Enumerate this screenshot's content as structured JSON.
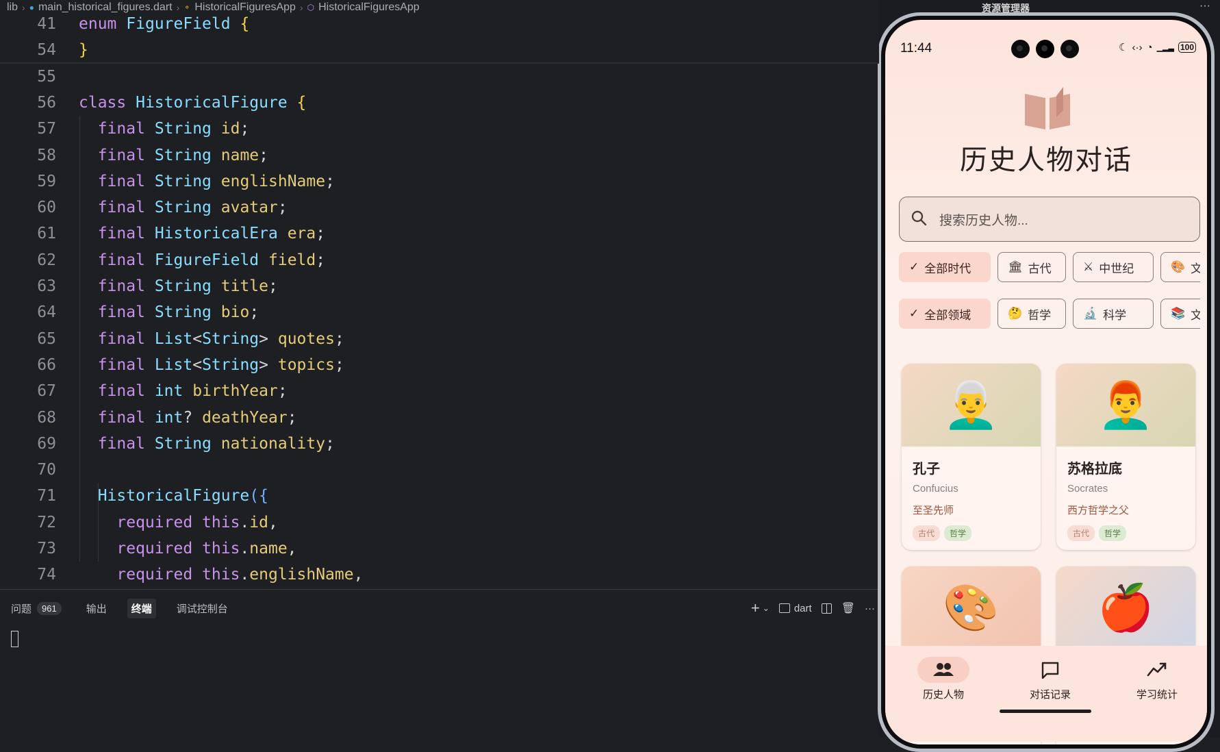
{
  "breadcrumb": {
    "root": "lib",
    "file": "main_historical_figures.dart",
    "class1": "HistoricalFiguresApp",
    "class2": "HistoricalFiguresApp"
  },
  "code": {
    "sticky": [
      {
        "num": "41",
        "tokens": [
          [
            "k",
            "enum"
          ],
          [
            "p",
            " "
          ],
          [
            "t",
            "FigureField"
          ],
          [
            "p",
            " "
          ],
          [
            "b",
            "{"
          ]
        ]
      },
      {
        "num": "54",
        "tokens": [
          [
            "b",
            "}"
          ]
        ]
      }
    ],
    "lines": [
      {
        "num": "55",
        "tokens": []
      },
      {
        "num": "56",
        "tokens": [
          [
            "k",
            "class"
          ],
          [
            "p",
            " "
          ],
          [
            "t",
            "HistoricalFigure"
          ],
          [
            "p",
            " "
          ],
          [
            "b",
            "{"
          ]
        ]
      },
      {
        "num": "57",
        "tokens": [
          [
            "p",
            "  "
          ],
          [
            "k",
            "final"
          ],
          [
            "p",
            " "
          ],
          [
            "t",
            "String"
          ],
          [
            "p",
            " "
          ],
          [
            "f",
            "id"
          ],
          [
            "p",
            ";"
          ]
        ]
      },
      {
        "num": "58",
        "tokens": [
          [
            "p",
            "  "
          ],
          [
            "k",
            "final"
          ],
          [
            "p",
            " "
          ],
          [
            "t",
            "String"
          ],
          [
            "p",
            " "
          ],
          [
            "f",
            "name"
          ],
          [
            "p",
            ";"
          ]
        ]
      },
      {
        "num": "59",
        "tokens": [
          [
            "p",
            "  "
          ],
          [
            "k",
            "final"
          ],
          [
            "p",
            " "
          ],
          [
            "t",
            "String"
          ],
          [
            "p",
            " "
          ],
          [
            "f",
            "englishName"
          ],
          [
            "p",
            ";"
          ]
        ]
      },
      {
        "num": "60",
        "tokens": [
          [
            "p",
            "  "
          ],
          [
            "k",
            "final"
          ],
          [
            "p",
            " "
          ],
          [
            "t",
            "String"
          ],
          [
            "p",
            " "
          ],
          [
            "f",
            "avatar"
          ],
          [
            "p",
            ";"
          ]
        ]
      },
      {
        "num": "61",
        "tokens": [
          [
            "p",
            "  "
          ],
          [
            "k",
            "final"
          ],
          [
            "p",
            " "
          ],
          [
            "t",
            "HistoricalEra"
          ],
          [
            "p",
            " "
          ],
          [
            "f",
            "era"
          ],
          [
            "p",
            ";"
          ]
        ]
      },
      {
        "num": "62",
        "tokens": [
          [
            "p",
            "  "
          ],
          [
            "k",
            "final"
          ],
          [
            "p",
            " "
          ],
          [
            "t",
            "FigureField"
          ],
          [
            "p",
            " "
          ],
          [
            "f",
            "field"
          ],
          [
            "p",
            ";"
          ]
        ]
      },
      {
        "num": "63",
        "tokens": [
          [
            "p",
            "  "
          ],
          [
            "k",
            "final"
          ],
          [
            "p",
            " "
          ],
          [
            "t",
            "String"
          ],
          [
            "p",
            " "
          ],
          [
            "f",
            "title"
          ],
          [
            "p",
            ";"
          ]
        ]
      },
      {
        "num": "64",
        "tokens": [
          [
            "p",
            "  "
          ],
          [
            "k",
            "final"
          ],
          [
            "p",
            " "
          ],
          [
            "t",
            "String"
          ],
          [
            "p",
            " "
          ],
          [
            "f",
            "bio"
          ],
          [
            "p",
            ";"
          ]
        ]
      },
      {
        "num": "65",
        "tokens": [
          [
            "p",
            "  "
          ],
          [
            "k",
            "final"
          ],
          [
            "p",
            " "
          ],
          [
            "t",
            "List"
          ],
          [
            "p",
            "<"
          ],
          [
            "t",
            "String"
          ],
          [
            "p",
            "> "
          ],
          [
            "f",
            "quotes"
          ],
          [
            "p",
            ";"
          ]
        ]
      },
      {
        "num": "66",
        "tokens": [
          [
            "p",
            "  "
          ],
          [
            "k",
            "final"
          ],
          [
            "p",
            " "
          ],
          [
            "t",
            "List"
          ],
          [
            "p",
            "<"
          ],
          [
            "t",
            "String"
          ],
          [
            "p",
            "> "
          ],
          [
            "f",
            "topics"
          ],
          [
            "p",
            ";"
          ]
        ]
      },
      {
        "num": "67",
        "tokens": [
          [
            "p",
            "  "
          ],
          [
            "k",
            "final"
          ],
          [
            "p",
            " "
          ],
          [
            "t",
            "int"
          ],
          [
            "p",
            " "
          ],
          [
            "f",
            "birthYear"
          ],
          [
            "p",
            ";"
          ]
        ]
      },
      {
        "num": "68",
        "tokens": [
          [
            "p",
            "  "
          ],
          [
            "k",
            "final"
          ],
          [
            "p",
            " "
          ],
          [
            "t",
            "int"
          ],
          [
            "p",
            "? "
          ],
          [
            "f",
            "deathYear"
          ],
          [
            "p",
            ";"
          ]
        ]
      },
      {
        "num": "69",
        "tokens": [
          [
            "p",
            "  "
          ],
          [
            "k",
            "final"
          ],
          [
            "p",
            " "
          ],
          [
            "t",
            "String"
          ],
          [
            "p",
            " "
          ],
          [
            "f",
            "nationality"
          ],
          [
            "p",
            ";"
          ]
        ]
      },
      {
        "num": "70",
        "tokens": []
      },
      {
        "num": "71",
        "tokens": [
          [
            "p",
            "  "
          ],
          [
            "t",
            "HistoricalFigure"
          ],
          [
            "b2",
            "({"
          ]
        ]
      },
      {
        "num": "72",
        "tokens": [
          [
            "p",
            "    "
          ],
          [
            "k",
            "required"
          ],
          [
            "p",
            " "
          ],
          [
            "k",
            "this"
          ],
          [
            "p",
            "."
          ],
          [
            "f",
            "id"
          ],
          [
            "p",
            ","
          ]
        ]
      },
      {
        "num": "73",
        "tokens": [
          [
            "p",
            "    "
          ],
          [
            "k",
            "required"
          ],
          [
            "p",
            " "
          ],
          [
            "k",
            "this"
          ],
          [
            "p",
            "."
          ],
          [
            "f",
            "name"
          ],
          [
            "p",
            ","
          ]
        ]
      },
      {
        "num": "74",
        "tokens": [
          [
            "p",
            "    "
          ],
          [
            "k",
            "required"
          ],
          [
            "p",
            " "
          ],
          [
            "k",
            "this"
          ],
          [
            "p",
            "."
          ],
          [
            "f",
            "englishName"
          ],
          [
            "p",
            ","
          ]
        ]
      }
    ]
  },
  "panel": {
    "tabs": [
      {
        "label": "问题",
        "badge": "961",
        "active": false
      },
      {
        "label": "输出",
        "active": false
      },
      {
        "label": "终端",
        "active": true
      },
      {
        "label": "调试控制台",
        "active": false
      }
    ],
    "actions": {
      "add": "+",
      "add_menu": "⌄",
      "terminal_name": "dart",
      "more": "···"
    }
  },
  "explorer": {
    "title": "资源管理器",
    "more": "···"
  },
  "phone": {
    "time": "11:44",
    "battery": "100",
    "app_title": "历史人物对话",
    "search_placeholder": "搜索历史人物...",
    "era_chips": [
      {
        "icon": "✓",
        "label": "全部时代",
        "selected": true
      },
      {
        "icon": "🏛",
        "label": "古代",
        "selected": false
      },
      {
        "icon": "⚔",
        "label": "中世纪",
        "selected": false
      },
      {
        "icon": "🎨",
        "label": "文",
        "selected": false
      }
    ],
    "field_chips": [
      {
        "icon": "✓",
        "label": "全部领域",
        "selected": true
      },
      {
        "icon": "🤔",
        "label": "哲学",
        "selected": false
      },
      {
        "icon": "🔬",
        "label": "科学",
        "selected": false
      },
      {
        "icon": "📚",
        "label": "文学",
        "selected": false
      }
    ],
    "figures": [
      {
        "emoji": "👨‍🦳",
        "name": "孔子",
        "english": "Confucius",
        "title": "至圣先师",
        "era": "古代",
        "field": "哲学",
        "bg": "linear-gradient(135deg,#f4d8c6,#d7d7b3)"
      },
      {
        "emoji": "👨‍🦰",
        "name": "苏格拉底",
        "english": "Socrates",
        "title": "西方哲学之父",
        "era": "古代",
        "field": "哲学",
        "bg": "linear-gradient(135deg,#f4d8c6,#d7d7b3)"
      },
      {
        "emoji": "🎨",
        "name": "",
        "english": "",
        "title": "",
        "era": "",
        "field": "",
        "bg": "linear-gradient(135deg,#f8d5c4,#f1c4b0)"
      },
      {
        "emoji": "🍎",
        "name": "",
        "english": "",
        "title": "",
        "era": "",
        "field": "",
        "bg": "linear-gradient(135deg,#f6d9c7,#cfd6e6)"
      }
    ],
    "nav": [
      {
        "icon": "people-icon",
        "label": "历史人物",
        "selected": true
      },
      {
        "icon": "chat-icon",
        "label": "对话记录",
        "selected": false
      },
      {
        "icon": "stats-icon",
        "label": "学习统计",
        "selected": false
      }
    ]
  }
}
